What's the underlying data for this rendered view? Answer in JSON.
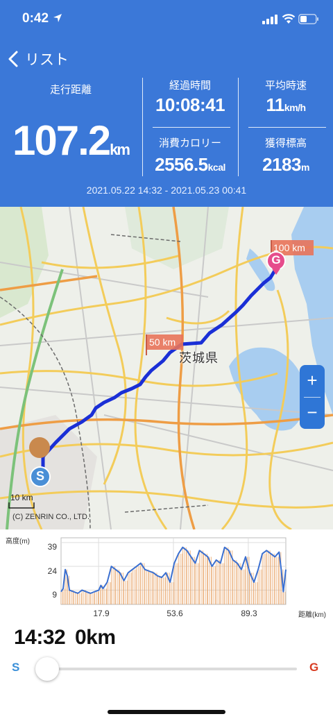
{
  "status_bar": {
    "time": "0:42"
  },
  "nav": {
    "back_label": "リスト"
  },
  "stats": {
    "distance": {
      "label": "走行距離",
      "value": "107.2",
      "unit": "km"
    },
    "elapsed": {
      "label": "経過時間",
      "value": "10:08:41"
    },
    "avg_speed": {
      "label": "平均時速",
      "value": "11",
      "unit": "km/h"
    },
    "calories": {
      "label": "消費カロリー",
      "value": "2556.5",
      "unit": "kcal"
    },
    "elevation_gain": {
      "label": "獲得標高",
      "value": "2183",
      "unit": "m"
    },
    "date_range": "2021.05.22 14:32 - 2021.05.23 00:41"
  },
  "map": {
    "prefecture_label": "茨城県",
    "marker_50": "50 km",
    "marker_100": "100 km",
    "start_label": "S",
    "goal_label": "G",
    "scale_label": "10 km",
    "copyright": "(C) ZENRIN CO., LTD.",
    "zoom_in": "+",
    "zoom_out": "−",
    "colors": {
      "route": "#1a2fd6",
      "start": "#4a8fd6",
      "goal": "#e64c8c",
      "marker": "#e8735a"
    }
  },
  "chart_data": {
    "type": "area",
    "ylabel": "高度(m)",
    "xlabel": "距離(km)",
    "ytick_labels": [
      "39",
      "24",
      "9"
    ],
    "xtick_labels": [
      "17.9",
      "53.6",
      "89.3"
    ],
    "ylim": [
      0,
      42
    ],
    "xlim": [
      0,
      107.2
    ],
    "x": [
      0,
      1,
      2,
      3,
      4,
      6,
      8,
      10,
      12,
      14,
      16,
      18,
      19,
      20,
      22,
      24,
      26,
      28,
      30,
      32,
      34,
      36,
      38,
      40,
      42,
      44,
      46,
      48,
      50,
      52,
      54,
      56,
      58,
      60,
      62,
      64,
      66,
      68,
      70,
      72,
      74,
      76,
      78,
      80,
      82,
      84,
      86,
      88,
      90,
      92,
      94,
      96,
      98,
      100,
      102,
      104,
      105,
      106,
      107.2
    ],
    "y": [
      8,
      10,
      22,
      18,
      9,
      8,
      7,
      9,
      8,
      7,
      8,
      9,
      12,
      10,
      14,
      24,
      22,
      20,
      15,
      20,
      22,
      24,
      26,
      22,
      21,
      20,
      18,
      17,
      20,
      14,
      26,
      32,
      36,
      34,
      30,
      26,
      34,
      32,
      30,
      24,
      28,
      26,
      36,
      34,
      28,
      26,
      22,
      30,
      20,
      14,
      22,
      32,
      34,
      32,
      30,
      33,
      22,
      8,
      22
    ],
    "series": [
      {
        "name": "高度",
        "line_color": "#3a6fd0",
        "fill_color": "#e8a468"
      }
    ]
  },
  "position": {
    "time": "14:32",
    "distance": "0km",
    "slider_value": 0
  },
  "slider": {
    "start_label": "S",
    "goal_label": "G"
  }
}
